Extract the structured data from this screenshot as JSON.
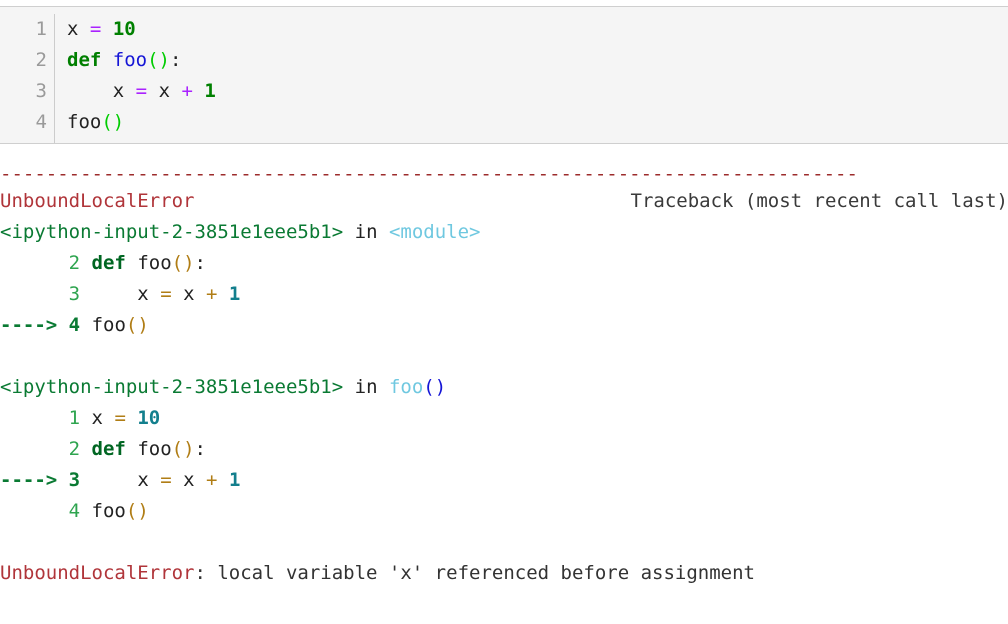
{
  "input_cell": {
    "line_numbers": [
      "1",
      "2",
      "3",
      "4"
    ],
    "lines": {
      "l1_var": "x",
      "l1_eq": "=",
      "l1_num": "10",
      "l2_def": "def",
      "l2_name": "foo",
      "l2_parens": "()",
      "l2_colon": ":",
      "l3_indent": "    ",
      "l3_var": "x",
      "l3_eq": "=",
      "l3_var2": "x",
      "l3_plus": "+",
      "l3_num": "1",
      "l4_name": "foo",
      "l4_parens": "()"
    }
  },
  "traceback": {
    "separator": "---------------------------------------------------------------------------",
    "error_name": "UnboundLocalError",
    "traceback_note": "Traceback (most recent call last)",
    "frame1": {
      "file": "<ipython-input-2-3851e1eee5b1>",
      "in_word": "in",
      "scope": "<module>",
      "rows": [
        {
          "arrow": "",
          "lineno": "2",
          "indent": " ",
          "code_def": "def",
          "code_name": "foo",
          "code_parens": "()",
          "code_colon": ":"
        },
        {
          "arrow": "",
          "lineno": "3",
          "indent": "     ",
          "var1": "x",
          "eq": "=",
          "var2": "x",
          "plus": "+",
          "num": "1"
        },
        {
          "arrow": "---->",
          "lineno": "4",
          "indent": " ",
          "name": "foo",
          "parens": "()"
        }
      ]
    },
    "frame2": {
      "file": "<ipython-input-2-3851e1eee5b1>",
      "in_word": "in",
      "scope": "foo",
      "scope_parens": "()",
      "rows": [
        {
          "arrow": "",
          "lineno": "1",
          "indent": " ",
          "var": "x",
          "eq": "=",
          "num": "10"
        },
        {
          "arrow": "",
          "lineno": "2",
          "indent": " ",
          "code_def": "def",
          "code_name": "foo",
          "code_parens": "()",
          "code_colon": ":"
        },
        {
          "arrow": "---->",
          "lineno": "3",
          "indent": "     ",
          "var1": "x",
          "eq": "=",
          "var2": "x",
          "plus": "+",
          "num": "1"
        },
        {
          "arrow": "",
          "lineno": "4",
          "indent": " ",
          "name": "foo",
          "parens": "()"
        }
      ]
    },
    "final": {
      "error_name": "UnboundLocalError",
      "message": ": local variable 'x' referenced before assignment"
    }
  },
  "colors": {
    "cell_bg": "#f5f5f5",
    "cell_border": "#cfcfcf",
    "error_red": "#b0353a",
    "separator_red": "#9c2b2b",
    "file_green": "#0a7a33",
    "scope_cyan": "#6fc8e0",
    "operator_gold": "#b07d15",
    "number_teal": "#137f8d"
  }
}
